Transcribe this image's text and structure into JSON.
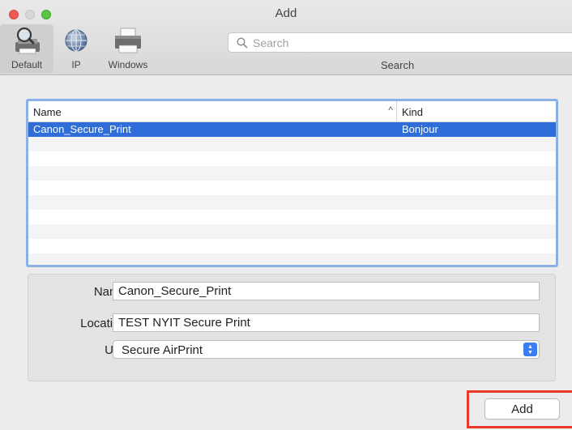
{
  "window": {
    "title": "Add"
  },
  "toolbar": {
    "tools": [
      {
        "label": "Default",
        "icon": "magnifier-printer-icon",
        "selected": true
      },
      {
        "label": "IP",
        "icon": "globe-icon"
      },
      {
        "label": "Windows",
        "icon": "printer-icon"
      }
    ],
    "search": {
      "placeholder": "Search",
      "value": "",
      "label": "Search"
    }
  },
  "printer_list": {
    "columns": [
      "Name",
      "Kind"
    ],
    "sort_indicator": "^",
    "rows": [
      {
        "name": "Canon_Secure_Print",
        "kind": "Bonjour",
        "selected": true
      }
    ]
  },
  "details": {
    "name_label": "Name:",
    "name_value": "Canon_Secure_Print",
    "location_label": "Location:",
    "location_value": "TEST NYIT Secure Print",
    "use_label": "Use:",
    "use_value": "Secure AirPrint"
  },
  "actions": {
    "add_label": "Add"
  },
  "colors": {
    "selection": "#2f6ed8",
    "list_focus_ring": "#8bb0e6",
    "highlight_box": "#ea3b2a",
    "close": "#ee5b55",
    "maximize": "#58c543"
  }
}
